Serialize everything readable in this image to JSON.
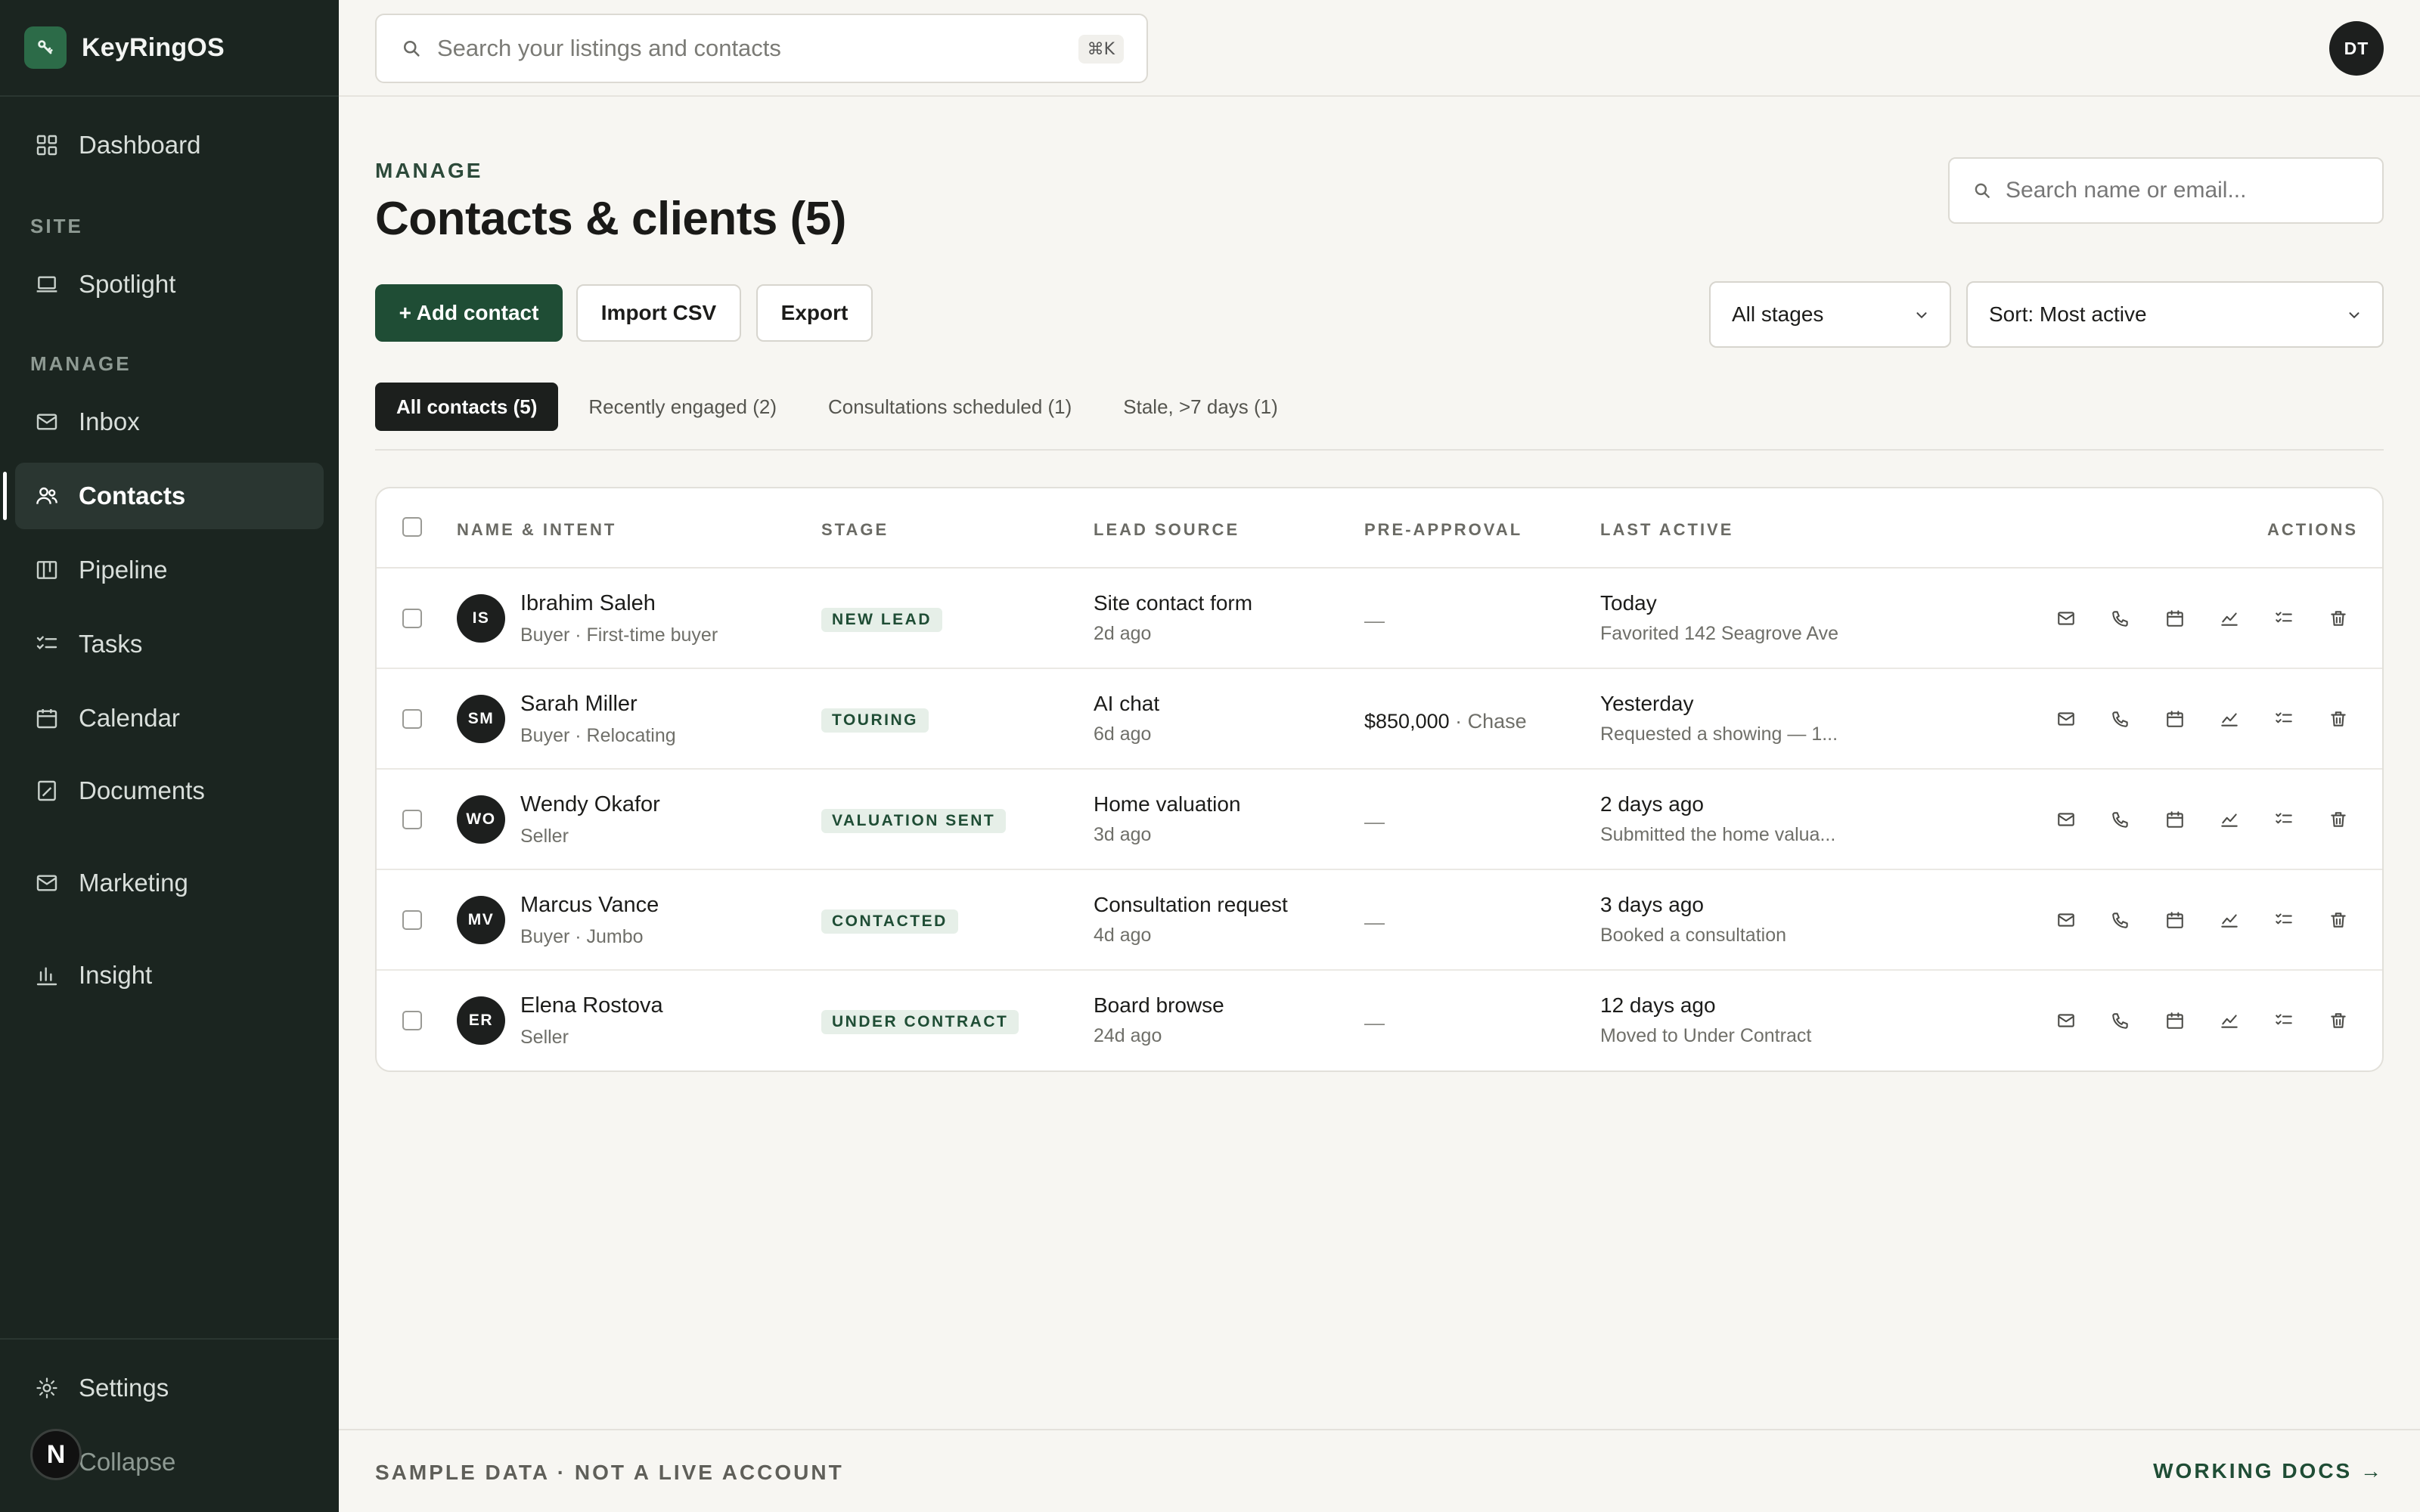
{
  "app": {
    "name": "KeyRingOS"
  },
  "sidebar": {
    "dashboard": "Dashboard",
    "section_site": "SITE",
    "spotlight": "Spotlight",
    "section_manage": "MANAGE",
    "inbox": "Inbox",
    "contacts": "Contacts",
    "pipeline": "Pipeline",
    "tasks": "Tasks",
    "calendar": "Calendar",
    "documents": "Documents",
    "marketing": "Marketing",
    "insight": "Insight",
    "settings": "Settings",
    "collapse": "Collapse",
    "badge": "N"
  },
  "topbar": {
    "search_placeholder": "Search your listings and contacts",
    "shortcut": "⌘K",
    "user_initials": "DT"
  },
  "page": {
    "eyebrow": "MANAGE",
    "title": "Contacts & clients (5)",
    "search_placeholder": "Search name or email...",
    "add_label": "+ Add contact",
    "import_label": "Import CSV",
    "export_label": "Export",
    "stage_filter": "All stages",
    "sort": "Sort: Most active"
  },
  "tabs": [
    {
      "label": "All contacts (5)"
    },
    {
      "label": "Recently engaged (2)"
    },
    {
      "label": "Consultations scheduled (1)"
    },
    {
      "label": "Stale, >7 days (1)"
    }
  ],
  "table": {
    "headers": {
      "name": "NAME & INTENT",
      "stage": "STAGE",
      "source": "LEAD SOURCE",
      "preapproval": "PRE-APPROVAL",
      "last_active": "LAST ACTIVE",
      "actions": "ACTIONS"
    },
    "rows": [
      {
        "initials": "IS",
        "name": "Ibrahim Saleh",
        "intent": "Buyer · First-time buyer",
        "stage": "NEW LEAD",
        "source": "Site contact form",
        "source_when": "2d ago",
        "preapproval": "—",
        "lender": "",
        "last_active": "Today",
        "last_note": "Favorited 142 Seagrove Ave"
      },
      {
        "initials": "SM",
        "name": "Sarah Miller",
        "intent": "Buyer · Relocating",
        "stage": "TOURING",
        "source": "AI chat",
        "source_when": "6d ago",
        "preapproval": "$850,000",
        "lender": " · Chase",
        "last_active": "Yesterday",
        "last_note": "Requested a showing — 1..."
      },
      {
        "initials": "WO",
        "name": "Wendy Okafor",
        "intent": "Seller",
        "stage": "VALUATION SENT",
        "source": "Home valuation",
        "source_when": "3d ago",
        "preapproval": "—",
        "lender": "",
        "last_active": "2 days ago",
        "last_note": "Submitted the home valua..."
      },
      {
        "initials": "MV",
        "name": "Marcus Vance",
        "intent": "Buyer · Jumbo",
        "stage": "CONTACTED",
        "source": "Consultation request",
        "source_when": "4d ago",
        "preapproval": "—",
        "lender": "",
        "last_active": "3 days ago",
        "last_note": "Booked a consultation"
      },
      {
        "initials": "ER",
        "name": "Elena Rostova",
        "intent": "Seller",
        "stage": "UNDER CONTRACT",
        "source": "Board browse",
        "source_when": "24d ago",
        "preapproval": "—",
        "lender": "",
        "last_active": "12 days ago",
        "last_note": "Moved to Under Contract"
      }
    ]
  },
  "footer": {
    "left": "SAMPLE DATA · NOT A LIVE ACCOUNT",
    "right": "WORKING DOCS →"
  },
  "colors": {
    "sidebar_bg": "#1b2520",
    "accent": "#1f4d35",
    "badge_bg": "#e6efe8"
  }
}
